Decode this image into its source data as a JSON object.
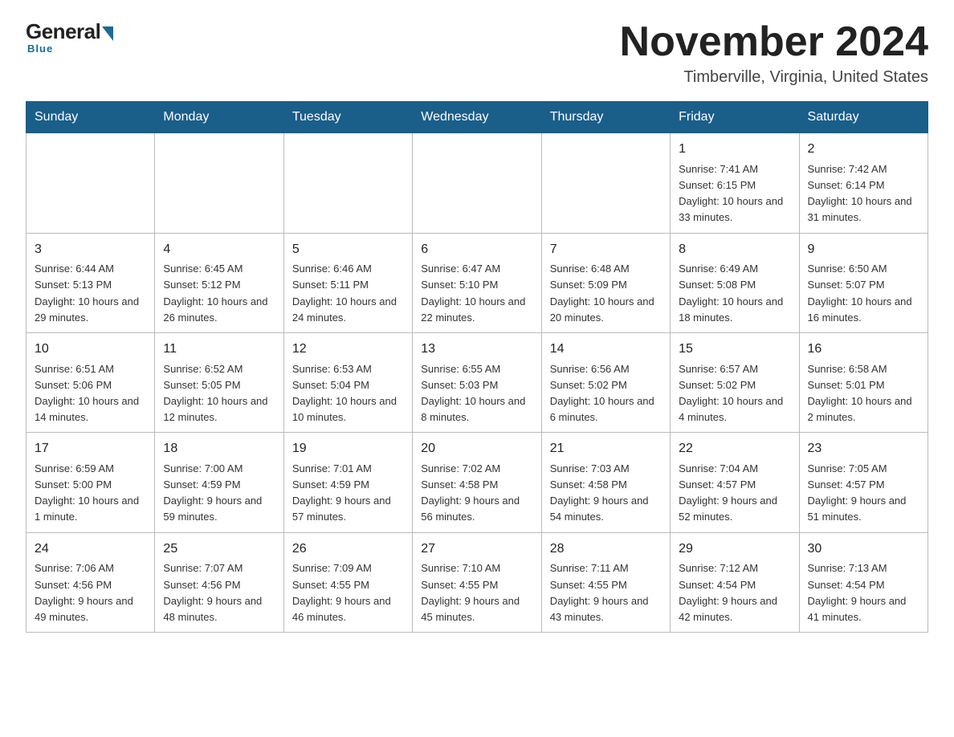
{
  "logo": {
    "general": "General",
    "blue": "Blue",
    "tagline": "Blue"
  },
  "header": {
    "title": "November 2024",
    "subtitle": "Timberville, Virginia, United States"
  },
  "days_of_week": [
    "Sunday",
    "Monday",
    "Tuesday",
    "Wednesday",
    "Thursday",
    "Friday",
    "Saturday"
  ],
  "weeks": [
    [
      {
        "day": "",
        "info": ""
      },
      {
        "day": "",
        "info": ""
      },
      {
        "day": "",
        "info": ""
      },
      {
        "day": "",
        "info": ""
      },
      {
        "day": "",
        "info": ""
      },
      {
        "day": "1",
        "info": "Sunrise: 7:41 AM\nSunset: 6:15 PM\nDaylight: 10 hours and 33 minutes."
      },
      {
        "day": "2",
        "info": "Sunrise: 7:42 AM\nSunset: 6:14 PM\nDaylight: 10 hours and 31 minutes."
      }
    ],
    [
      {
        "day": "3",
        "info": "Sunrise: 6:44 AM\nSunset: 5:13 PM\nDaylight: 10 hours and 29 minutes."
      },
      {
        "day": "4",
        "info": "Sunrise: 6:45 AM\nSunset: 5:12 PM\nDaylight: 10 hours and 26 minutes."
      },
      {
        "day": "5",
        "info": "Sunrise: 6:46 AM\nSunset: 5:11 PM\nDaylight: 10 hours and 24 minutes."
      },
      {
        "day": "6",
        "info": "Sunrise: 6:47 AM\nSunset: 5:10 PM\nDaylight: 10 hours and 22 minutes."
      },
      {
        "day": "7",
        "info": "Sunrise: 6:48 AM\nSunset: 5:09 PM\nDaylight: 10 hours and 20 minutes."
      },
      {
        "day": "8",
        "info": "Sunrise: 6:49 AM\nSunset: 5:08 PM\nDaylight: 10 hours and 18 minutes."
      },
      {
        "day": "9",
        "info": "Sunrise: 6:50 AM\nSunset: 5:07 PM\nDaylight: 10 hours and 16 minutes."
      }
    ],
    [
      {
        "day": "10",
        "info": "Sunrise: 6:51 AM\nSunset: 5:06 PM\nDaylight: 10 hours and 14 minutes."
      },
      {
        "day": "11",
        "info": "Sunrise: 6:52 AM\nSunset: 5:05 PM\nDaylight: 10 hours and 12 minutes."
      },
      {
        "day": "12",
        "info": "Sunrise: 6:53 AM\nSunset: 5:04 PM\nDaylight: 10 hours and 10 minutes."
      },
      {
        "day": "13",
        "info": "Sunrise: 6:55 AM\nSunset: 5:03 PM\nDaylight: 10 hours and 8 minutes."
      },
      {
        "day": "14",
        "info": "Sunrise: 6:56 AM\nSunset: 5:02 PM\nDaylight: 10 hours and 6 minutes."
      },
      {
        "day": "15",
        "info": "Sunrise: 6:57 AM\nSunset: 5:02 PM\nDaylight: 10 hours and 4 minutes."
      },
      {
        "day": "16",
        "info": "Sunrise: 6:58 AM\nSunset: 5:01 PM\nDaylight: 10 hours and 2 minutes."
      }
    ],
    [
      {
        "day": "17",
        "info": "Sunrise: 6:59 AM\nSunset: 5:00 PM\nDaylight: 10 hours and 1 minute."
      },
      {
        "day": "18",
        "info": "Sunrise: 7:00 AM\nSunset: 4:59 PM\nDaylight: 9 hours and 59 minutes."
      },
      {
        "day": "19",
        "info": "Sunrise: 7:01 AM\nSunset: 4:59 PM\nDaylight: 9 hours and 57 minutes."
      },
      {
        "day": "20",
        "info": "Sunrise: 7:02 AM\nSunset: 4:58 PM\nDaylight: 9 hours and 56 minutes."
      },
      {
        "day": "21",
        "info": "Sunrise: 7:03 AM\nSunset: 4:58 PM\nDaylight: 9 hours and 54 minutes."
      },
      {
        "day": "22",
        "info": "Sunrise: 7:04 AM\nSunset: 4:57 PM\nDaylight: 9 hours and 52 minutes."
      },
      {
        "day": "23",
        "info": "Sunrise: 7:05 AM\nSunset: 4:57 PM\nDaylight: 9 hours and 51 minutes."
      }
    ],
    [
      {
        "day": "24",
        "info": "Sunrise: 7:06 AM\nSunset: 4:56 PM\nDaylight: 9 hours and 49 minutes."
      },
      {
        "day": "25",
        "info": "Sunrise: 7:07 AM\nSunset: 4:56 PM\nDaylight: 9 hours and 48 minutes."
      },
      {
        "day": "26",
        "info": "Sunrise: 7:09 AM\nSunset: 4:55 PM\nDaylight: 9 hours and 46 minutes."
      },
      {
        "day": "27",
        "info": "Sunrise: 7:10 AM\nSunset: 4:55 PM\nDaylight: 9 hours and 45 minutes."
      },
      {
        "day": "28",
        "info": "Sunrise: 7:11 AM\nSunset: 4:55 PM\nDaylight: 9 hours and 43 minutes."
      },
      {
        "day": "29",
        "info": "Sunrise: 7:12 AM\nSunset: 4:54 PM\nDaylight: 9 hours and 42 minutes."
      },
      {
        "day": "30",
        "info": "Sunrise: 7:13 AM\nSunset: 4:54 PM\nDaylight: 9 hours and 41 minutes."
      }
    ]
  ]
}
